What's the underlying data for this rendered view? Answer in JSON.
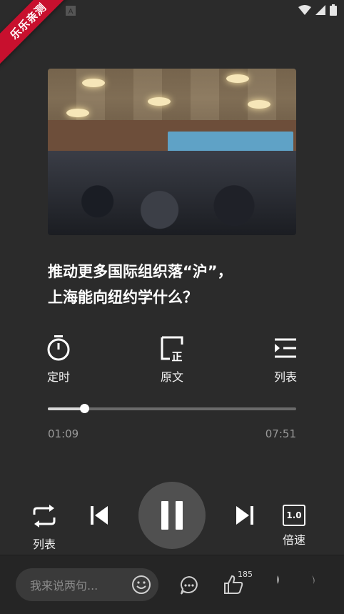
{
  "status_bar": {
    "app_icon": "a-icon",
    "icons": [
      "wifi-icon",
      "signal-icon",
      "battery-icon"
    ]
  },
  "ribbon": {
    "text": "乐乐亲测"
  },
  "article": {
    "title_line1": "推动更多国际组织落“沪”，",
    "title_line2": "上海能向纽约学什么？"
  },
  "tools": {
    "timer_label": "定时",
    "original_label": "原文",
    "playlist_label": "列表"
  },
  "progress": {
    "elapsed": "01:09",
    "total": "07:51",
    "fraction": 0.1465
  },
  "controls": {
    "loop_label": "列表",
    "speed_label": "倍速",
    "speed_value": "1.0",
    "state": "playing"
  },
  "bottom_bar": {
    "comment_placeholder": "我来说两句...",
    "like_count": "185"
  },
  "colors": {
    "background": "#2b2b2b",
    "ribbon": "#c8102e",
    "play_button": "#505050"
  }
}
